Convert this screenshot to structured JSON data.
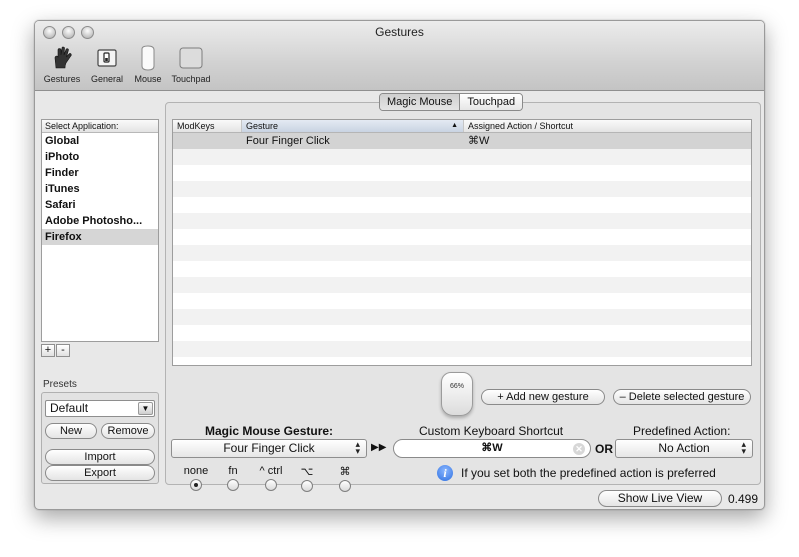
{
  "window": {
    "title": "Gestures"
  },
  "toolbar": {
    "items": [
      {
        "label": "Gestures",
        "icon": "hand-icon"
      },
      {
        "label": "General",
        "icon": "switch-icon"
      },
      {
        "label": "Mouse",
        "icon": "mouse-icon"
      },
      {
        "label": "Touchpad",
        "icon": "touchpad-icon"
      }
    ]
  },
  "applications": {
    "header": "Select Application:",
    "items": [
      "Global",
      "iPhoto",
      "Finder",
      "iTunes",
      "Safari",
      "Adobe Photosho...",
      "Firefox"
    ],
    "selected_index": 6,
    "add_label": "+",
    "remove_label": "-"
  },
  "presets": {
    "label": "Presets",
    "selected": "Default",
    "new_label": "New",
    "remove_label": "Remove",
    "import_label": "Import",
    "export_label": "Export"
  },
  "device_tabs": {
    "items": [
      "Magic Mouse",
      "Touchpad"
    ],
    "active_index": 0
  },
  "table": {
    "columns": [
      "ModKeys",
      "Gesture",
      "Assigned Action / Shortcut"
    ],
    "rows": [
      {
        "modkeys": "",
        "gesture": "Four Finger Click",
        "action": "⌘W"
      }
    ]
  },
  "mouse_badge": "66%",
  "buttons": {
    "add_gesture": "+ Add new gesture",
    "delete_gesture": "– Delete selected gesture",
    "show_live_view": "Show Live View"
  },
  "editor": {
    "gesture_label": "Magic Mouse Gesture:",
    "gesture_value": "Four Finger Click",
    "arrows": "▶▶",
    "shortcut_label": "Custom Keyboard Shortcut",
    "shortcut_value": "⌘W",
    "or_label": "OR",
    "predefined_label": "Predefined Action:",
    "predefined_value": "No Action",
    "modifiers": [
      {
        "label": "none",
        "checked": true
      },
      {
        "label": "fn",
        "checked": false
      },
      {
        "label": "^ ctrl",
        "checked": false
      },
      {
        "label": "⌥",
        "checked": false
      },
      {
        "label": "⌘",
        "checked": false
      }
    ],
    "info_text": "If you set both the predefined action is preferred"
  },
  "version": "0.499"
}
